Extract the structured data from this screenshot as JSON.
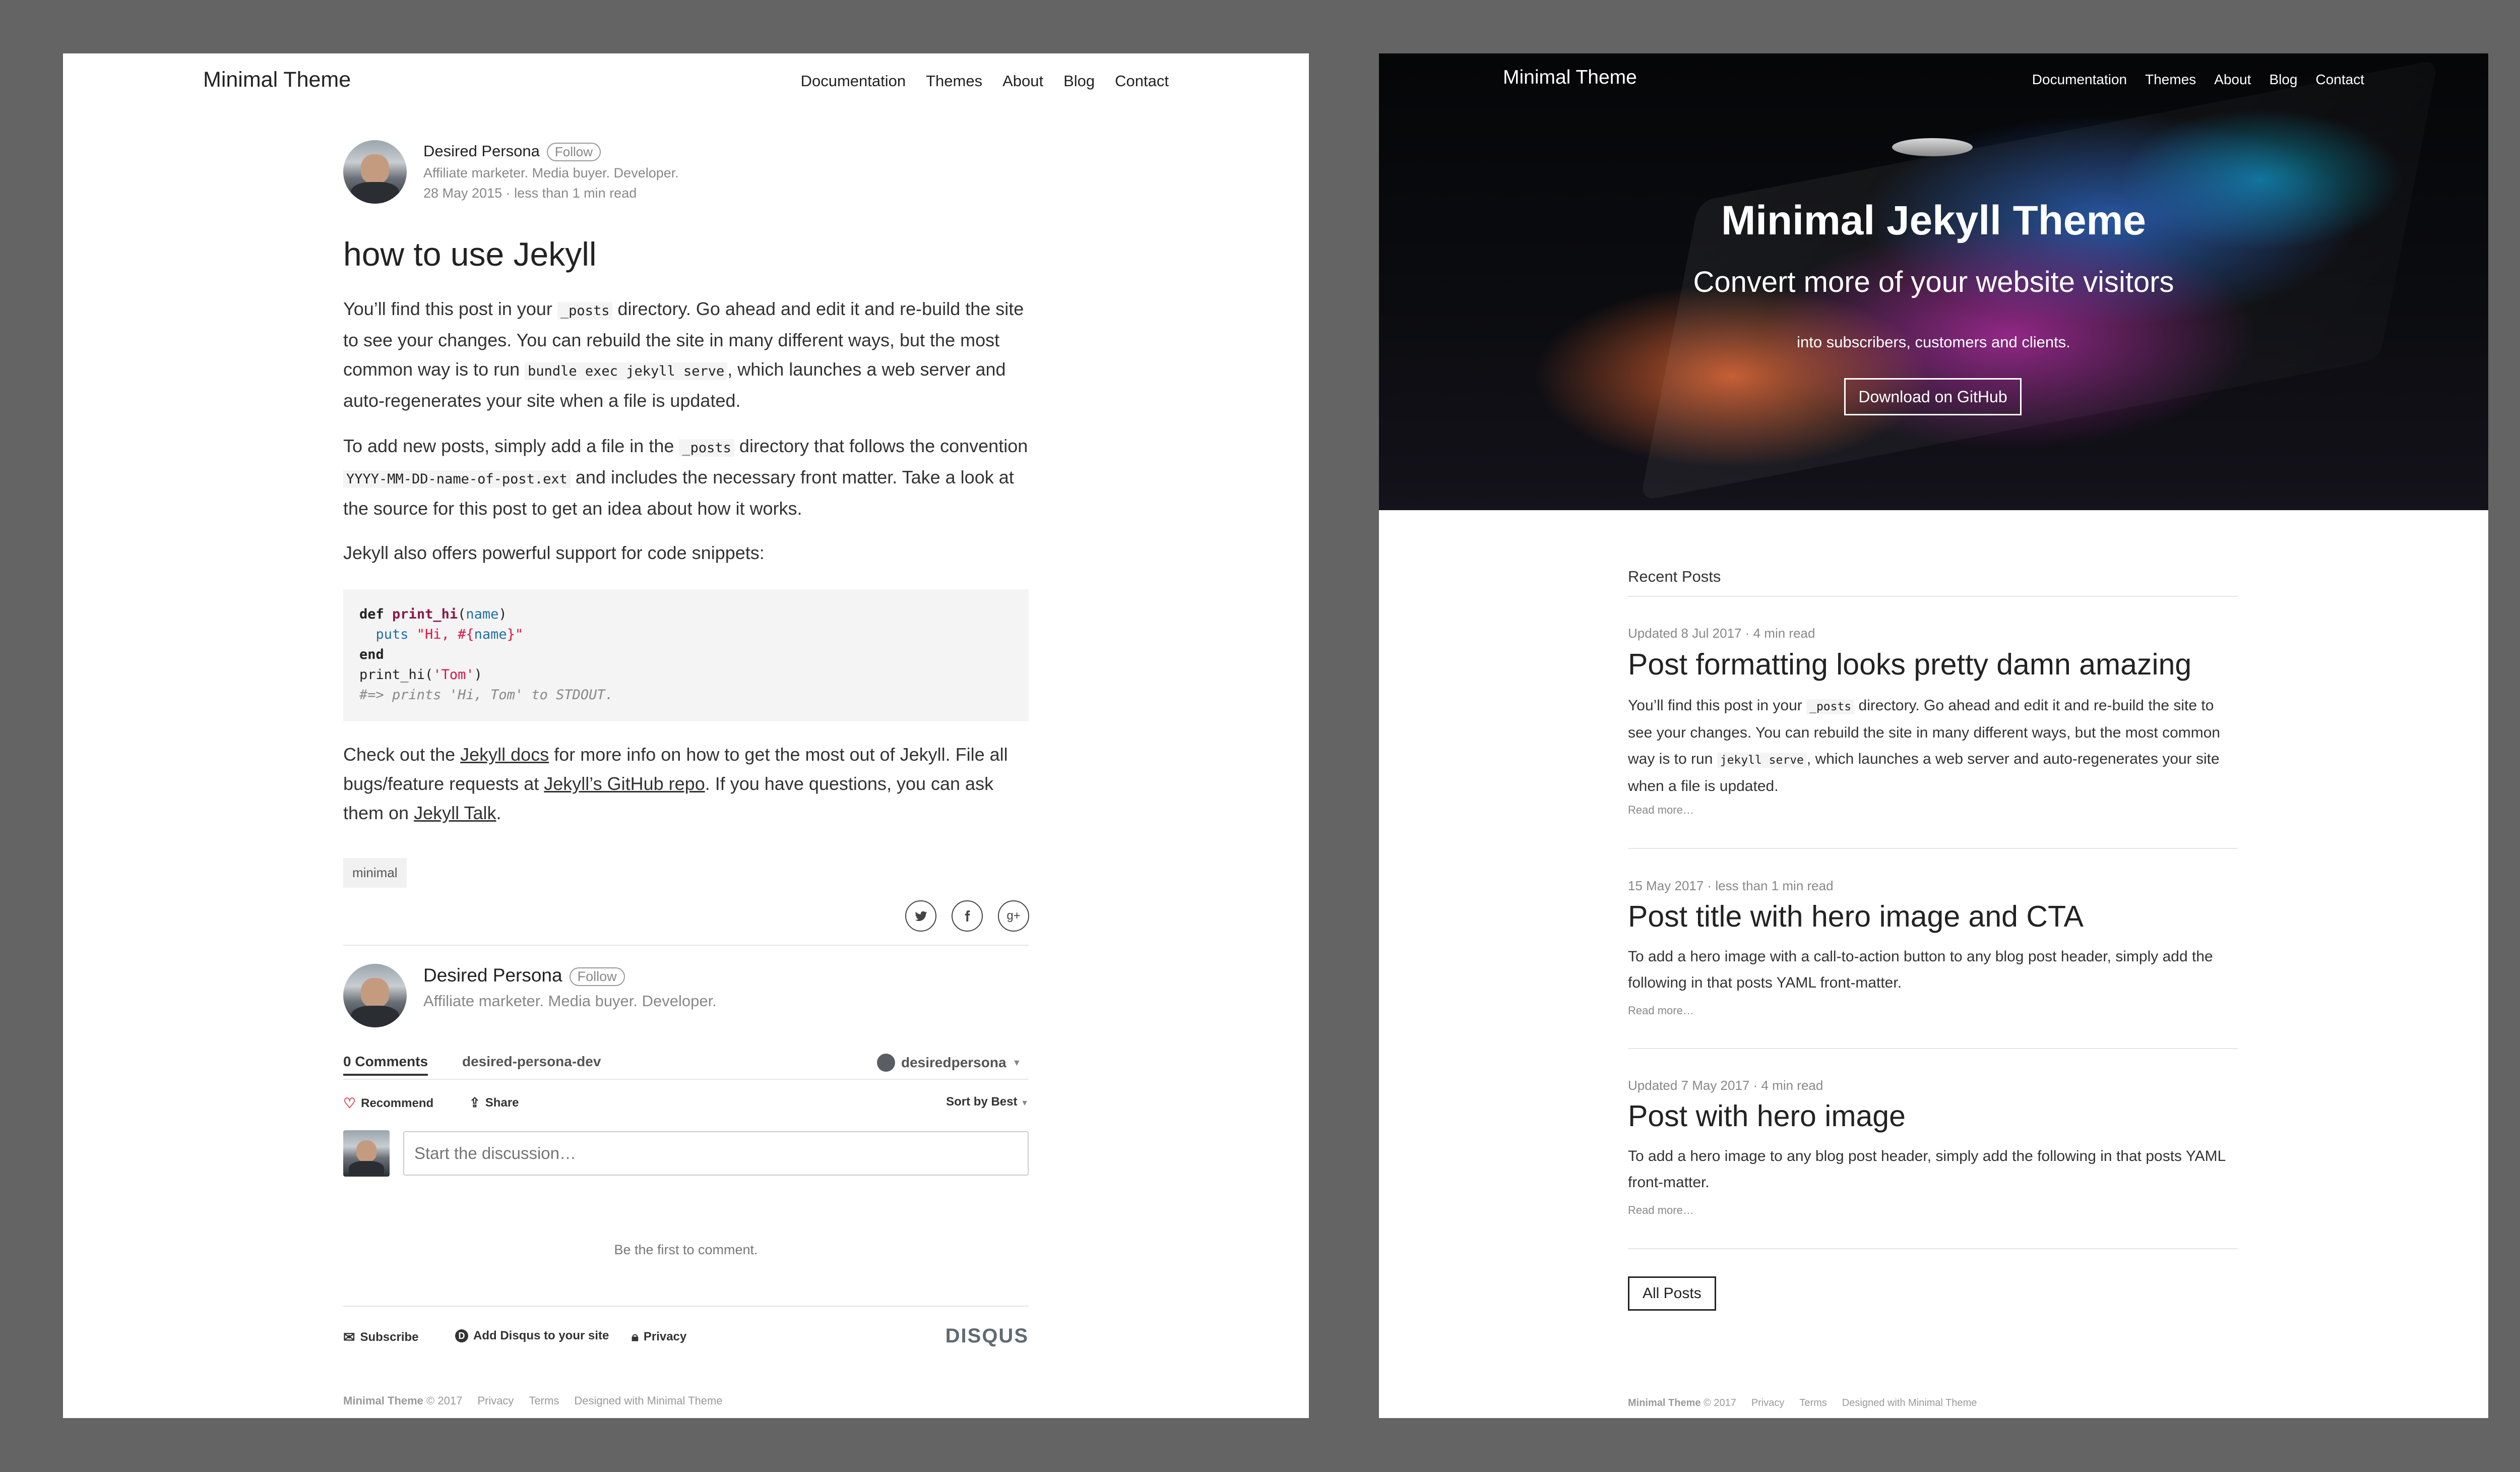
{
  "left": {
    "brand": "Minimal Theme",
    "nav": [
      "Documentation",
      "Themes",
      "About",
      "Blog",
      "Contact"
    ],
    "author": {
      "name": "Desired Persona",
      "follow": "Follow",
      "bio": "Affiliate marketer. Media buyer. Developer.",
      "meta": "28 May 2015 · less than 1 min read"
    },
    "title": "how to use Jekyll",
    "p1": {
      "a": "You’ll find this post in your ",
      "code1": "_posts",
      "b": " directory. Go ahead and edit it and re-build the site to see your changes. You can rebuild the site in many different ways, but the most common way is to run ",
      "code2": "bundle exec jekyll serve",
      "c": ", which launches a web server and auto-regenerates your site when a file is updated."
    },
    "p2": {
      "a": "To add new posts, simply add a file in the ",
      "code1": "_posts",
      "b": " directory that follows the convention ",
      "code2": "YYYY-MM-DD-name-of-post.ext",
      "c": " and includes the necessary front matter. Take a look at the source for this post to get an idea about how it works."
    },
    "p3": "Jekyll also offers powerful support for code snippets:",
    "code": {
      "l1_kw": "def",
      "l1_fn": "print_hi",
      "l1_open": "(",
      "l1_arg": "name",
      "l1_close": ")",
      "l2_puts": "  puts ",
      "l2_str_a": "\"Hi, #{",
      "l2_var": "name",
      "l2_str_b": "}\"",
      "l3_kw": "end",
      "l4_call": "print_hi(",
      "l4_str": "'Tom'",
      "l4_close": ")",
      "l5_comment": "#=> prints 'Hi, Tom' to STDOUT."
    },
    "p4": {
      "a": "Check out the ",
      "link1": "Jekyll docs",
      "b": " for more info on how to get the most out of Jekyll. File all bugs/feature requests at ",
      "link2": "Jekyll’s GitHub repo",
      "c": ". If you have questions, you can ask them on ",
      "link3": "Jekyll Talk",
      "d": "."
    },
    "tag": "minimal",
    "share": {
      "twitter_icon": "twitter-icon",
      "facebook_icon": "facebook-icon",
      "google_plus_icon": "google-plus-icon"
    },
    "author_box": {
      "name": "Desired Persona",
      "follow": "Follow",
      "bio": "Affiliate marketer. Media buyer. Developer."
    },
    "disqus": {
      "comments_tab": "0 Comments",
      "community_tab": "desired-persona-dev",
      "user": "desiredpersona",
      "recommend": "Recommend",
      "share": "Share",
      "sort": "Sort by Best",
      "placeholder": "Start the discussion…",
      "empty": "Be the first to comment.",
      "subscribe": "Subscribe",
      "add_disqus": "Add Disqus to your site",
      "privacy": "Privacy",
      "logo": "DISQUS"
    },
    "footer": {
      "brand": "Minimal Theme",
      "copyright": " © 2017",
      "privacy": "Privacy",
      "terms": "Terms",
      "designed": "Designed with Minimal Theme"
    }
  },
  "right": {
    "brand": "Minimal Theme",
    "nav": [
      "Documentation",
      "Themes",
      "About",
      "Blog",
      "Contact"
    ],
    "hero": {
      "title": "Minimal Jekyll Theme",
      "subtitle": "Convert more of your website visitors",
      "small": "into subscribers, customers and clients.",
      "button": "Download on GitHub"
    },
    "recent_heading": "Recent Posts",
    "posts": [
      {
        "meta": "Updated 8 Jul 2017 · 4 min read",
        "title": "Post formatting looks pretty damn amazing",
        "ex_a": "You’ll find this post in your ",
        "ex_code1": "_posts",
        "ex_b": " directory. Go ahead and edit it and re-build the site to see your changes. You can rebuild the site in many different ways, but the most common way is to run ",
        "ex_code2": "jekyll serve",
        "ex_c": ", which launches a web server and auto-regenerates your site when a file is updated.",
        "read_more": "Read more…"
      },
      {
        "meta": "15 May 2017 · less than 1 min read",
        "title": "Post title with hero image and CTA",
        "ex_a": "To add a hero image with a call-to-action button to any blog post header, simply add the following in that posts YAML front-matter.",
        "read_more": "Read more…"
      },
      {
        "meta": "Updated 7 May 2017 · 4 min read",
        "title": "Post with hero image",
        "ex_a": "To add a hero image to any blog post header, simply add the following in that posts YAML front-matter.",
        "read_more": "Read more…"
      }
    ],
    "all_posts": "All Posts",
    "footer": {
      "brand": "Minimal Theme",
      "copyright": " © 2017",
      "privacy": "Privacy",
      "terms": "Terms",
      "designed": "Designed with Minimal Theme"
    }
  },
  "colors": {
    "backdrop": "#646464",
    "text": "#222222",
    "muted": "#888888",
    "recommend_heart": "#e0394d"
  }
}
